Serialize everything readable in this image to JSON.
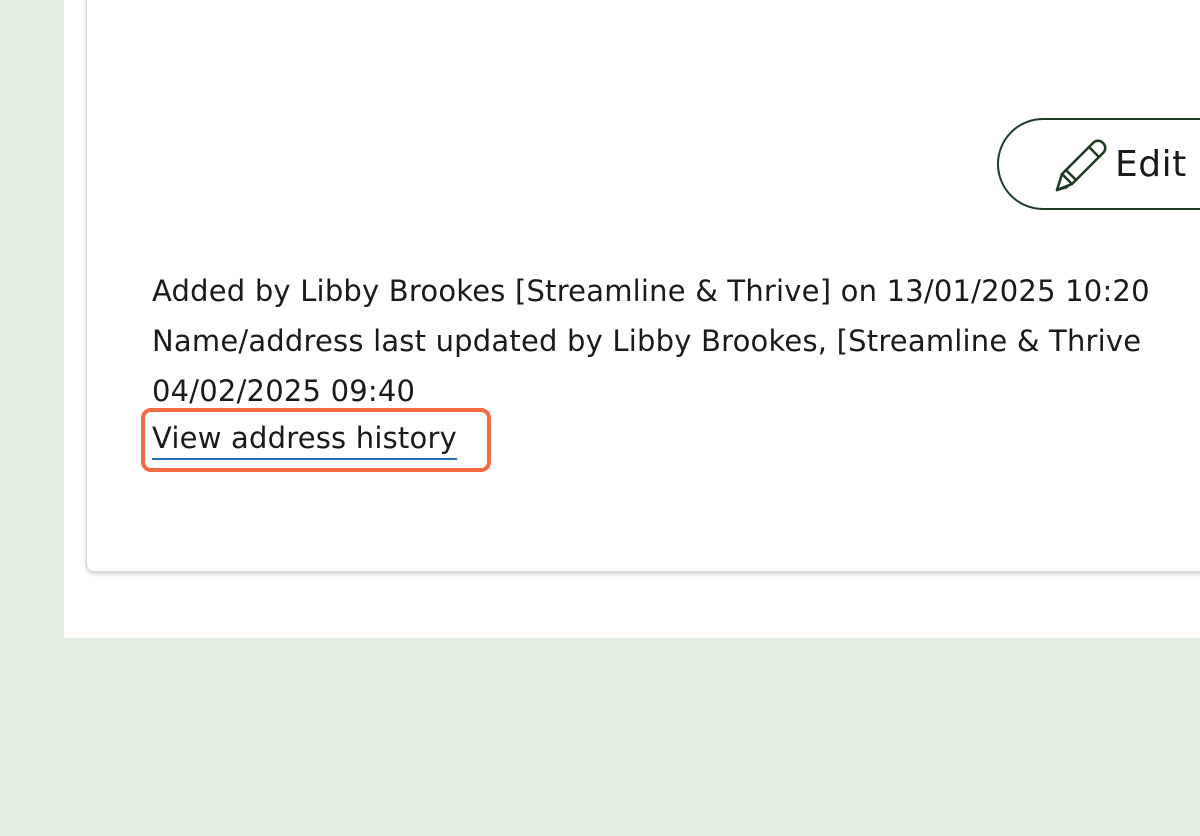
{
  "edit_button": {
    "label": "Edit",
    "icon": "pencil-icon"
  },
  "audit": {
    "added_line": "Added by Libby Brookes [Streamline & Thrive] on 13/01/2025 10:20",
    "updated_line": "Name/address last updated by Libby Brookes, [Streamline & Thrive",
    "updated_date": "04/02/2025 09:40"
  },
  "history_link": {
    "label": "View address history"
  },
  "colors": {
    "page_background": "#e3ede2",
    "card_background": "#ffffff",
    "button_border": "#1f3a25",
    "link_underline": "#2b6cb0",
    "highlight": "#f26b43"
  }
}
